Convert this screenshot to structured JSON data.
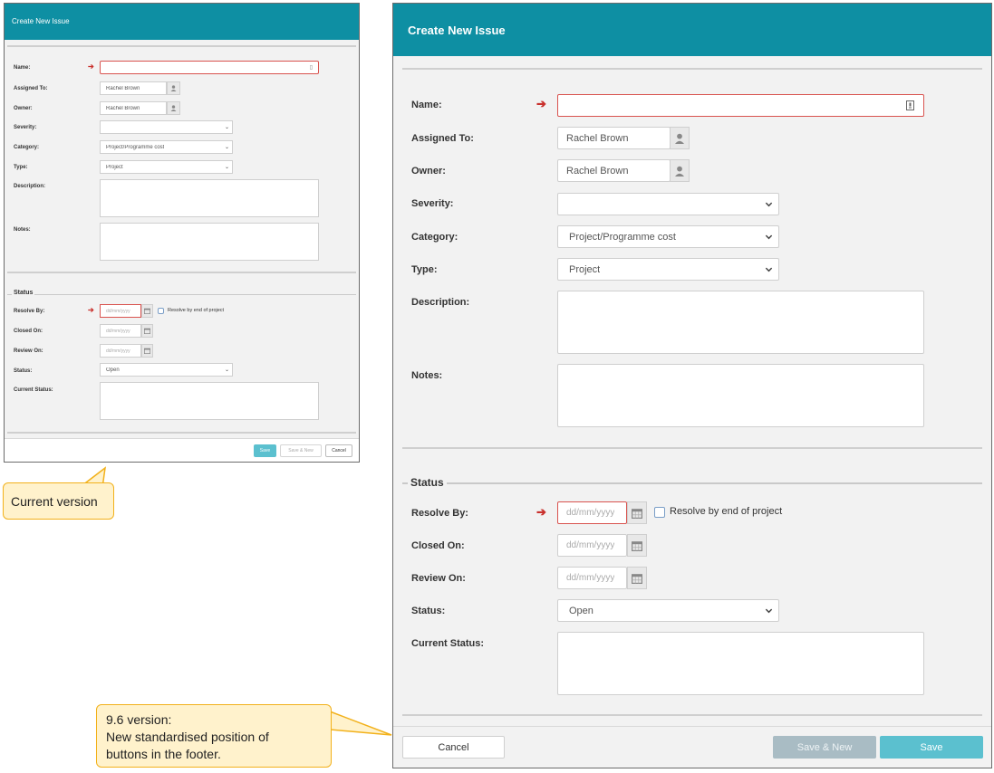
{
  "dialog": {
    "title": "Create New Issue",
    "labels": {
      "name": "Name:",
      "assigned_to": "Assigned To:",
      "owner": "Owner:",
      "severity": "Severity:",
      "category": "Category:",
      "type": "Type:",
      "description": "Description:",
      "notes": "Notes:",
      "resolve_by": "Resolve By:",
      "closed_on": "Closed On:",
      "review_on": "Review On:",
      "status": "Status:",
      "current_status": "Current Status:"
    },
    "values": {
      "name": "",
      "assigned_to": "Rachel Brown",
      "owner": "Rachel Brown",
      "severity": "",
      "category": "Project/Programme cost",
      "type": "Project",
      "status": "Open"
    },
    "date_placeholder": "dd/mm/yyyy",
    "section_status": "Status",
    "resolve_checkbox_label": "Resolve by end of project",
    "buttons": {
      "save": "Save",
      "save_new": "Save & New",
      "cancel": "Cancel"
    },
    "colors": {
      "header": "#0e8fa3",
      "required": "#c9302c",
      "save_button": "#5bc0cf",
      "save_new_button": "#a9bcc4"
    }
  },
  "callouts": {
    "current": "Current version",
    "new_line1": "9.6 version:",
    "new_line2": "New standardised position of",
    "new_line3": "buttons in the footer."
  },
  "icons": {
    "user": "person-icon",
    "calendar": "calendar-icon",
    "required": "arrow-right-icon",
    "dropdown": "chevron-down-icon"
  }
}
